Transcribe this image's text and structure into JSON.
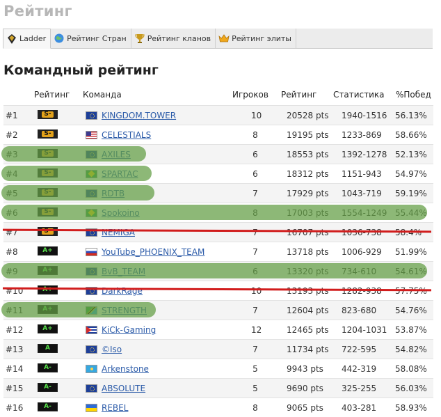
{
  "page": {
    "title": "Рейтинг"
  },
  "tabs": [
    {
      "label": "Ladder",
      "icon": "ladder-icon",
      "active": true
    },
    {
      "label": "Рейтинг Стран",
      "icon": "globe-icon",
      "active": false
    },
    {
      "label": "Рейтинг кланов",
      "icon": "trophy-icon",
      "active": false
    },
    {
      "label": "Рейтинг элиты",
      "icon": "crown-icon",
      "active": false
    }
  ],
  "section": {
    "title": "Командный рейтинг"
  },
  "table": {
    "headers": {
      "rank": "",
      "badge": "Рейтинг",
      "team": "Команда",
      "players": "Игроков",
      "rating": "Рейтинг",
      "stats": "Статистика",
      "winrate": "%Побед"
    },
    "rows": [
      {
        "rank": "#1",
        "tier": "S-",
        "flag": "eu",
        "team": "KINGDOM.TOWER",
        "players": "10",
        "rating": "20528 pts",
        "stats": "1940-1516",
        "winrate": "56.13%"
      },
      {
        "rank": "#2",
        "tier": "S-",
        "flag": "us",
        "team": "CELESTIALS",
        "players": "8",
        "rating": "19195 pts",
        "stats": "1233-869",
        "winrate": "58.66%"
      },
      {
        "rank": "#3",
        "tier": "S-",
        "flag": "eu",
        "team": "AXILES",
        "players": "6",
        "rating": "18553 pts",
        "stats": "1392-1278",
        "winrate": "52.13%"
      },
      {
        "rank": "#4",
        "tier": "S-",
        "flag": "br",
        "team": "SPARTAC",
        "players": "6",
        "rating": "18312 pts",
        "stats": "1151-943",
        "winrate": "54.97%"
      },
      {
        "rank": "#5",
        "tier": "S-",
        "flag": "eu",
        "team": "RDTB",
        "players": "7",
        "rating": "17929 pts",
        "stats": "1043-719",
        "winrate": "59.19%"
      },
      {
        "rank": "#6",
        "tier": "S-",
        "flag": "br",
        "team": "Spokoino",
        "players": "8",
        "rating": "17003 pts",
        "stats": "1554-1249",
        "winrate": "55.44%"
      },
      {
        "rank": "#7",
        "tier": "S-",
        "flag": "eu",
        "team": "NEMIGA",
        "players": "7",
        "rating": "16707 pts",
        "stats": "1036-738",
        "winrate": "58.4%"
      },
      {
        "rank": "#8",
        "tier": "A+",
        "flag": "ru",
        "team": "YouTube_PHOENIX_TEAM",
        "players": "7",
        "rating": "13718 pts",
        "stats": "1006-929",
        "winrate": "51.99%"
      },
      {
        "rank": "#9",
        "tier": "A+",
        "flag": "eu",
        "team": "BvB_TEAM",
        "players": "6",
        "rating": "13320 pts",
        "stats": "734-610",
        "winrate": "54.61%"
      },
      {
        "rank": "#10",
        "tier": "A+",
        "flag": "eu",
        "team": "DarkRage",
        "players": "10",
        "rating": "13193 pts",
        "stats": "1282-938",
        "winrate": "57.75%"
      },
      {
        "rank": "#11",
        "tier": "A+",
        "flag": "tz",
        "team": "STRENGTH",
        "players": "7",
        "rating": "12604 pts",
        "stats": "823-680",
        "winrate": "54.76%"
      },
      {
        "rank": "#12",
        "tier": "A+",
        "flag": "cu",
        "team": "KiCk-Gaming",
        "players": "12",
        "rating": "12465 pts",
        "stats": "1204-1031",
        "winrate": "53.87%"
      },
      {
        "rank": "#13",
        "tier": "A",
        "flag": "eu",
        "team": "©Iso",
        "players": "7",
        "rating": "11734 pts",
        "stats": "722-595",
        "winrate": "54.82%"
      },
      {
        "rank": "#14",
        "tier": "A-",
        "flag": "kz",
        "team": "Arkenstone",
        "players": "5",
        "rating": "9943 pts",
        "stats": "442-319",
        "winrate": "58.08%"
      },
      {
        "rank": "#15",
        "tier": "A-",
        "flag": "eu",
        "team": "ABSOLUTE",
        "players": "5",
        "rating": "9690 pts",
        "stats": "325-255",
        "winrate": "56.03%"
      },
      {
        "rank": "#16",
        "tier": "A-",
        "flag": "ua",
        "team": "REBEL",
        "players": "8",
        "rating": "9065 pts",
        "stats": "403-281",
        "winrate": "58.93%"
      }
    ]
  },
  "annotations": {
    "highlighted_ranks": [
      "#3",
      "#4",
      "#5",
      "#6",
      "#9",
      "#11"
    ],
    "struck_ranks": [
      "#7",
      "#10"
    ],
    "highlight_color": "#649e46",
    "strike_color": "#d11c1c"
  }
}
